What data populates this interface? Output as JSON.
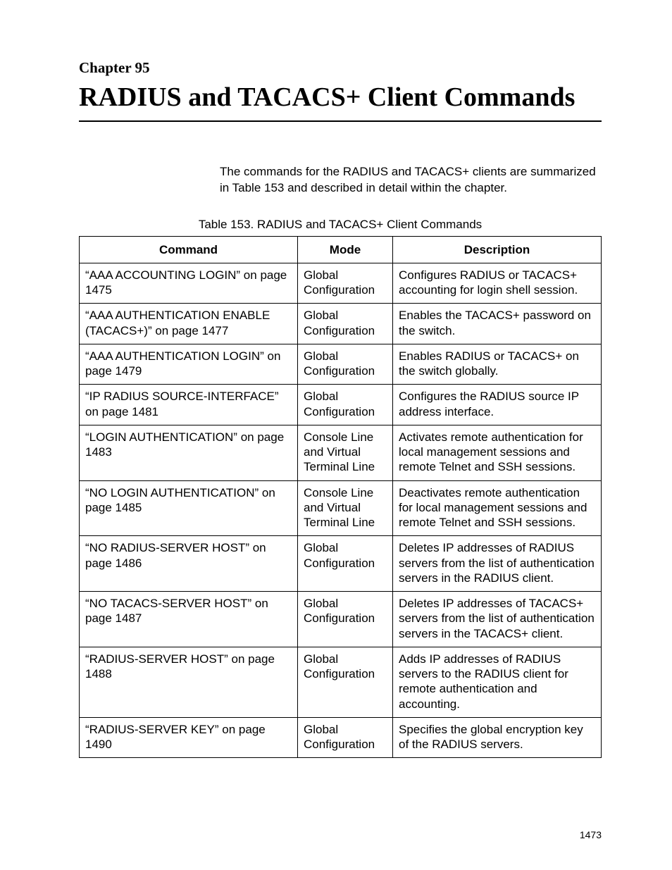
{
  "chapter_label": "Chapter 95",
  "chapter_title": "RADIUS and TACACS+ Client Commands",
  "intro": "The commands for the RADIUS and TACACS+ clients are summarized in Table 153 and described in detail within the chapter.",
  "table_caption": "Table 153. RADIUS and TACACS+ Client Commands",
  "headers": {
    "command": "Command",
    "mode": "Mode",
    "description": "Description"
  },
  "rows": [
    {
      "command": "“AAA ACCOUNTING LOGIN” on page 1475",
      "mode": "Global Configuration",
      "description": "Configures RADIUS or TACACS+ accounting for login shell session."
    },
    {
      "command": "“AAA AUTHENTICATION ENABLE (TACACS+)” on page 1477",
      "mode": "Global Configuration",
      "description": "Enables the TACACS+ password on the switch."
    },
    {
      "command": "“AAA AUTHENTICATION LOGIN” on page 1479",
      "mode": "Global Configuration",
      "description": "Enables RADIUS or TACACS+ on the switch globally."
    },
    {
      "command": "“IP RADIUS SOURCE-INTERFACE” on page 1481",
      "mode": "Global Configuration",
      "description": "Configures the RADIUS source IP address interface."
    },
    {
      "command": "“LOGIN AUTHENTICATION” on page 1483",
      "mode": "Console Line and Virtual Terminal Line",
      "description": "Activates remote authentication for local management sessions and remote Telnet and SSH sessions."
    },
    {
      "command": "“NO LOGIN AUTHENTICATION” on page 1485",
      "mode": "Console Line and Virtual Terminal Line",
      "description": "Deactivates remote authentication for local management sessions and remote Telnet and SSH sessions."
    },
    {
      "command": "“NO RADIUS-SERVER HOST” on page 1486",
      "mode": "Global Configuration",
      "description": "Deletes IP addresses of RADIUS servers from the list of authentication servers in the RADIUS client."
    },
    {
      "command": "“NO TACACS-SERVER HOST” on page 1487",
      "mode": "Global Configuration",
      "description": "Deletes IP addresses of TACACS+ servers from the list of authentication servers in the TACACS+ client."
    },
    {
      "command": "“RADIUS-SERVER HOST” on page 1488",
      "mode": "Global Configuration",
      "description": "Adds IP addresses of RADIUS servers to the RADIUS client for remote authentication and accounting."
    },
    {
      "command": "“RADIUS-SERVER KEY” on page 1490",
      "mode": "Global Configuration",
      "description": "Specifies the global encryption key of the RADIUS servers."
    }
  ],
  "page_number": "1473"
}
